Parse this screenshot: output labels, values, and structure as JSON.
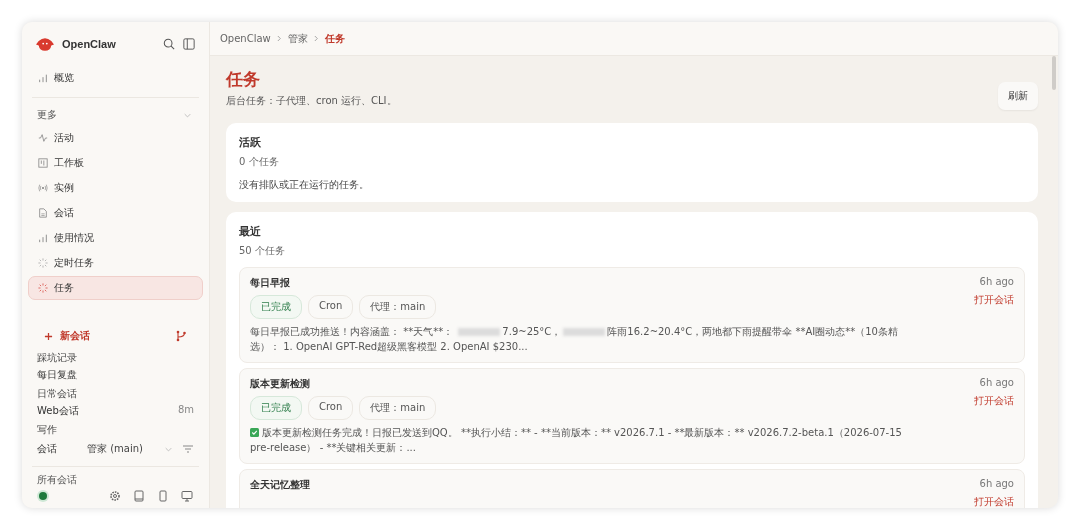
{
  "sidebar": {
    "brand": "OpenClaw",
    "top_items": [
      {
        "label": "概览",
        "selected": false
      }
    ],
    "section": {
      "label": "更多",
      "expanded": true
    },
    "items": [
      {
        "label": "活动",
        "selected": false
      },
      {
        "label": "工作板",
        "selected": false
      },
      {
        "label": "实例",
        "selected": false
      },
      {
        "label": "会话",
        "selected": false
      },
      {
        "label": "使用情况",
        "selected": false
      },
      {
        "label": "定时任务",
        "selected": false
      },
      {
        "label": "任务",
        "selected": true
      }
    ],
    "new_session": "新会话",
    "sessions": [
      {
        "kind": "group",
        "label": "踩坑记录"
      },
      {
        "kind": "item",
        "label": "每日复盘"
      },
      {
        "kind": "group",
        "label": "日常会话"
      },
      {
        "kind": "item",
        "label": "Web会话",
        "time": "8m"
      },
      {
        "kind": "group",
        "label": "写作"
      }
    ],
    "session_filter": {
      "label": "会话",
      "value": "管家 (main)"
    },
    "all_sessions": "所有会话",
    "connected": true
  },
  "breadcrumb": [
    {
      "label": "OpenClaw",
      "current": false
    },
    {
      "label": "管家",
      "current": false
    },
    {
      "label": "任务",
      "current": true
    }
  ],
  "page": {
    "title": "任务",
    "subtitle": "后台任务：子代理、cron 运行、CLI。",
    "refresh": "刷新"
  },
  "active": {
    "title": "活跃",
    "count": "0 个任务",
    "empty": "没有排队或正在运行的任务。"
  },
  "recent": {
    "title": "最近",
    "count": "50 个任务",
    "tasks": [
      {
        "title": "每日早报",
        "tags": [
          {
            "label": "已完成",
            "kind": "status"
          },
          {
            "label": "Cron",
            "kind": "plain"
          },
          {
            "label": "代理：main",
            "kind": "plain"
          }
        ],
        "time": "6h ago",
        "link": "打开会话",
        "summary": [
          {
            "kind": "text",
            "text": "每日早报已成功推送！内容涵盖： **天气**： "
          },
          {
            "kind": "redacted"
          },
          {
            "kind": "text",
            "text": "7.9~25°C，"
          },
          {
            "kind": "redacted"
          },
          {
            "kind": "text",
            "text": "阵雨16.2~20.4°C，两地都下雨提醒带伞 **AI圈动态**（10条精选）： 1. OpenAI GPT-Red超级黑客模型 2. OpenAI $230..."
          }
        ]
      },
      {
        "title": "版本更新检测",
        "tags": [
          {
            "label": "已完成",
            "kind": "status"
          },
          {
            "label": "Cron",
            "kind": "plain"
          },
          {
            "label": "代理：main",
            "kind": "plain"
          }
        ],
        "time": "6h ago",
        "link": "打开会话",
        "summary": [
          {
            "kind": "check"
          },
          {
            "kind": "text",
            "text": "版本更新检测任务完成！日报已发送到QQ。 **执行小结：** - **当前版本：** v2026.7.1 - **最新版本：** v2026.7.2-beta.1（2026-07-15 pre-release） - **关键相关更新：..."
          }
        ]
      },
      {
        "title": "全天记忆整理",
        "time": "6h ago",
        "link": "打开会话"
      }
    ]
  }
}
